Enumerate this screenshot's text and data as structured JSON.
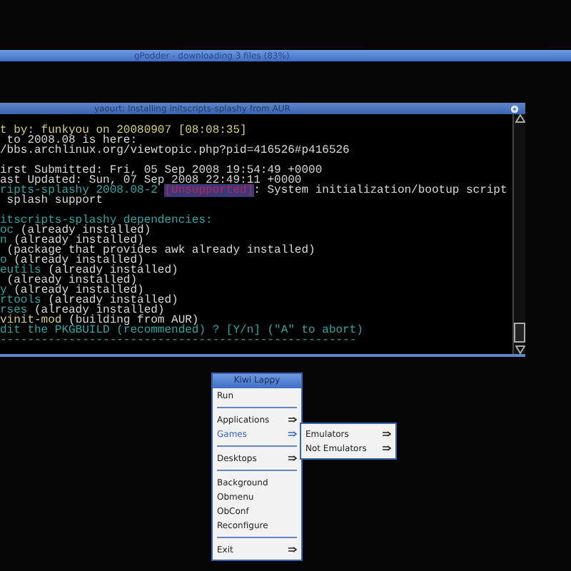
{
  "background_window": {
    "title": "gPodder - downloading 3 files (83%)"
  },
  "terminal": {
    "title": "yaourt: Installing initscripts-splashy from AUR",
    "lines": [
      {
        "kind": "text",
        "segments": [
          {
            "kind": "yellow",
            "text": "t by: funkyou on 20080907 [08:08:35]"
          }
        ]
      },
      {
        "kind": "text",
        "segments": [
          {
            "kind": "plain",
            "text": " to 2008.08 is here:"
          }
        ]
      },
      {
        "kind": "text",
        "segments": [
          {
            "kind": "plain",
            "text": "/bbs.archlinux.org/viewtopic.php?pid=416526#p416526"
          }
        ]
      },
      {
        "kind": "blank"
      },
      {
        "kind": "text",
        "segments": [
          {
            "kind": "plain",
            "text": "irst Submitted: Fri, 05 Sep 2008 19:54:49 +0000"
          }
        ]
      },
      {
        "kind": "text",
        "segments": [
          {
            "kind": "plain",
            "text": "ast Updated: Sun, 07 Sep 2008 22:49:11 +0000"
          }
        ]
      },
      {
        "kind": "text",
        "segments": [
          {
            "kind": "cyan",
            "text": "ripts-splashy 2008.08-2 "
          },
          {
            "kind": "tag",
            "text": "[Unsupported]"
          },
          {
            "kind": "plain",
            "text": ": System initialization/bootup script"
          }
        ]
      },
      {
        "kind": "text",
        "segments": [
          {
            "kind": "plain",
            "text": " splash support"
          }
        ]
      },
      {
        "kind": "blank"
      },
      {
        "kind": "text",
        "segments": [
          {
            "kind": "cyan",
            "text": "itscripts-splashy dependencies:"
          }
        ]
      },
      {
        "kind": "text",
        "segments": [
          {
            "kind": "cyan",
            "text": "oc"
          },
          {
            "kind": "plain",
            "text": " (already installed)"
          }
        ]
      },
      {
        "kind": "text",
        "segments": [
          {
            "kind": "cyan",
            "text": "n"
          },
          {
            "kind": "plain",
            "text": " (already installed)"
          }
        ]
      },
      {
        "kind": "text",
        "segments": [
          {
            "kind": "plain",
            "text": " (package that provides awk already installed)"
          }
        ]
      },
      {
        "kind": "text",
        "segments": [
          {
            "kind": "cyan",
            "text": "o"
          },
          {
            "kind": "plain",
            "text": " (already installed)"
          }
        ]
      },
      {
        "kind": "text",
        "segments": [
          {
            "kind": "cyan",
            "text": "eutils"
          },
          {
            "kind": "plain",
            "text": " (already installed)"
          }
        ]
      },
      {
        "kind": "text",
        "segments": [
          {
            "kind": "plain",
            "text": " (already installed)"
          }
        ]
      },
      {
        "kind": "text",
        "segments": [
          {
            "kind": "cyan",
            "text": "y"
          },
          {
            "kind": "plain",
            "text": " (already installed)"
          }
        ]
      },
      {
        "kind": "text",
        "segments": [
          {
            "kind": "cyan",
            "text": "rtools"
          },
          {
            "kind": "plain",
            "text": " (already installed)"
          }
        ]
      },
      {
        "kind": "text",
        "segments": [
          {
            "kind": "cyan",
            "text": "rses"
          },
          {
            "kind": "plain",
            "text": " (already installed)"
          }
        ]
      },
      {
        "kind": "text",
        "segments": [
          {
            "kind": "yellow",
            "text": "vinit-mod"
          },
          {
            "kind": "plain",
            "text": " (building from AUR)"
          }
        ]
      },
      {
        "kind": "text",
        "segments": [
          {
            "kind": "cyan",
            "text": "dit the PKGBUILD (recommended) ? [Y/n] (\"A\" to abort)"
          }
        ]
      },
      {
        "kind": "text",
        "segments": [
          {
            "kind": "cyan",
            "text": "----------------------------------------------------"
          }
        ]
      }
    ]
  },
  "menu": {
    "title": "Kiwi Lappy",
    "items": [
      {
        "kind": "item",
        "label": "Run",
        "submenu": false,
        "selected": false
      },
      {
        "kind": "separator"
      },
      {
        "kind": "item",
        "label": "Applications",
        "submenu": true,
        "selected": false
      },
      {
        "kind": "item",
        "label": "Games",
        "submenu": true,
        "selected": true
      },
      {
        "kind": "separator"
      },
      {
        "kind": "item",
        "label": "Desktops",
        "submenu": true,
        "selected": false
      },
      {
        "kind": "separator"
      },
      {
        "kind": "item",
        "label": "Background",
        "submenu": false,
        "selected": false
      },
      {
        "kind": "item",
        "label": "Obmenu",
        "submenu": false,
        "selected": false
      },
      {
        "kind": "item",
        "label": "ObConf",
        "submenu": false,
        "selected": false
      },
      {
        "kind": "item",
        "label": "Reconfigure",
        "submenu": false,
        "selected": false
      },
      {
        "kind": "separator"
      },
      {
        "kind": "item",
        "label": "Exit",
        "submenu": true,
        "selected": false
      }
    ],
    "submenu": {
      "items": [
        {
          "label": "Emulators",
          "submenu": true
        },
        {
          "label": "Not Emulators",
          "submenu": true
        }
      ]
    }
  }
}
